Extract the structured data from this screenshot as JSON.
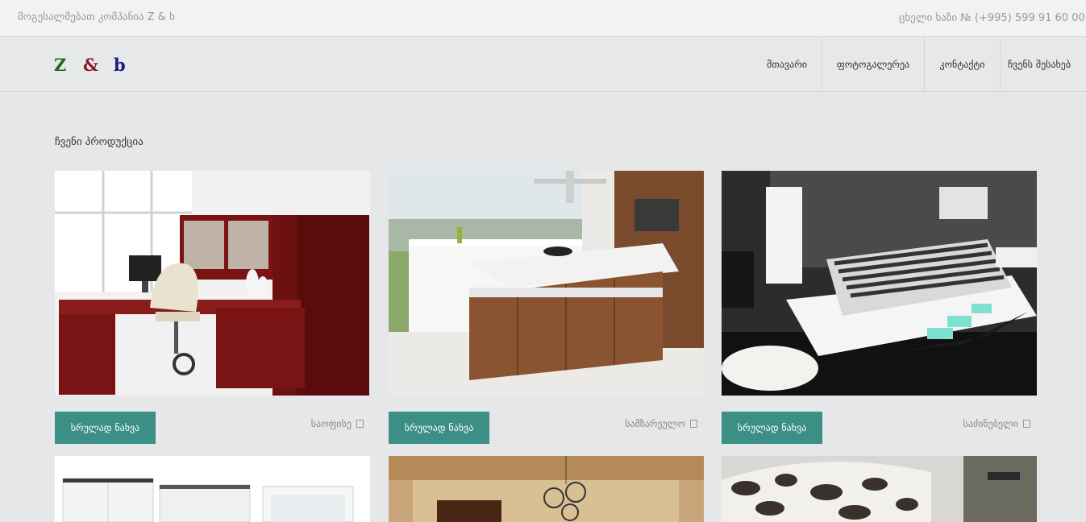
{
  "topbar": {
    "welcome": "მოგესალმებათ კომპანია Z & ხ",
    "hotline": "ცხელი ხაზი № (+995) 599 91 60 00"
  },
  "logo": {
    "z": "Z",
    "amp": "&",
    "b": "b"
  },
  "nav": {
    "items": [
      {
        "label": "მთავარი"
      },
      {
        "label": "ფოტოგალერეა"
      },
      {
        "label": "კონტაქტი"
      },
      {
        "label": "ჩვენს შესახებ"
      }
    ]
  },
  "main": {
    "section_title": "ჩვენი პროდუქცია",
    "products": [
      {
        "button": "სრულად ნახვა",
        "category": "საოფისე",
        "photo": "office-furniture"
      },
      {
        "button": "სრულად ნახვა",
        "category": "სამზარეულო",
        "photo": "kitchen-island"
      },
      {
        "button": "სრულად ნახვა",
        "category": "საძინებელი",
        "photo": "bedroom-set"
      },
      {
        "photo": "white-cabinets"
      },
      {
        "photo": "living-room-ceiling"
      },
      {
        "photo": "patterned-sofa"
      }
    ]
  },
  "colors": {
    "accent": "#3b8f84",
    "logo_z": "#1e6b1e",
    "logo_amp": "#8a1a2a",
    "logo_b": "#1a1a8a"
  }
}
